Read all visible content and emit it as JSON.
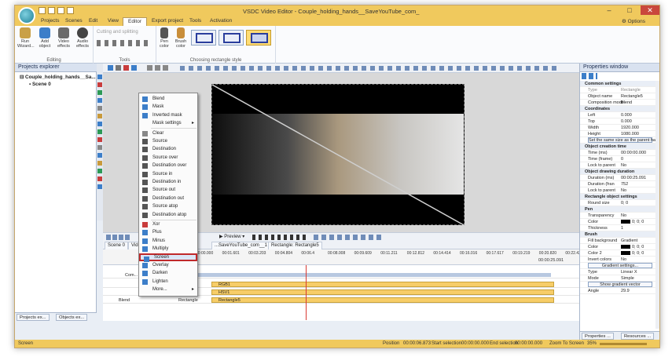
{
  "title": "VSDC Video Editor - Couple_holding_hands__SaveYouTube_com_",
  "window_controls": [
    "–",
    "□",
    "✕"
  ],
  "menu": {
    "items": [
      "Projects",
      "Scenes",
      "Edit",
      "View",
      "Editor",
      "Export project",
      "Tools",
      "Activation"
    ],
    "active": "Editor",
    "options": "Options"
  },
  "ribbon": {
    "editing_group": "Editing",
    "tools_group": "Tools",
    "styles_group": "Choosing rectangle style",
    "run_wizard": "Run Wizard...",
    "add_object": "Add object",
    "video_effects": "Video effects",
    "audio_effects": "Audio effects",
    "cutting": "Cutting and splitting",
    "pen_color": "Pen color",
    "brush_color": "Brush color"
  },
  "projects_explorer": {
    "title": "Projects explorer",
    "project": "Couple_holding_hands__Sa...",
    "scene": "Scene 0",
    "bottom_tabs": [
      "Projects ex...",
      "Objects ex..."
    ]
  },
  "context_menu": {
    "items": [
      "Blend",
      "Mask",
      "Inverted mask",
      "Mask settings",
      "Clear",
      "Source",
      "Destination",
      "Source over",
      "Destination over",
      "Source in",
      "Destination in",
      "Source out",
      "Destination out",
      "Source atop",
      "Destination atop",
      "Xor",
      "Plus",
      "Minus",
      "Multiply",
      "Screen",
      "Overlay",
      "Darken",
      "Lighten",
      "More..."
    ],
    "highlighted": "Screen"
  },
  "playbar": {
    "preview": "Preview"
  },
  "timeline": {
    "tabs": [
      "Scene 0",
      "Video",
      "...SaveYouTube_com__1",
      "Rectangle: Rectangle5"
    ],
    "ruler_ticks": [
      "00:00.000",
      "00:01.601",
      "00:03.203",
      "00:04.804",
      "00:06.4",
      "00:08.008",
      "00:09.609",
      "00:11.211",
      "00:12.812",
      "00:14.414",
      "00:16.016",
      "00:17.617",
      "00:19.219",
      "00:20.820",
      "00:22.422",
      "00:24.024",
      "00:25.625",
      "00:27.2"
    ],
    "end_time": "00:00:25.091",
    "layer_label": "Com...",
    "blend_label": "Blend",
    "tracks": [
      "RGB1",
      "HSV1",
      "Rectangle5"
    ],
    "rect_row_label": "Rectangle"
  },
  "properties": {
    "title": "Properties window",
    "rows": [
      {
        "type": "sec",
        "k": "Common settings"
      },
      {
        "type": "dim",
        "k": "Type",
        "v": "Rectangle"
      },
      {
        "type": "row",
        "k": "Object name",
        "v": "Rectangle5"
      },
      {
        "type": "row",
        "k": "Composition mode",
        "v": "Blend"
      },
      {
        "type": "sec",
        "k": "Coordinates"
      },
      {
        "type": "row",
        "k": "Left",
        "v": "0.000"
      },
      {
        "type": "row",
        "k": "Top",
        "v": "0.000"
      },
      {
        "type": "row",
        "k": "Width",
        "v": "1920.000"
      },
      {
        "type": "row",
        "k": "Height",
        "v": "1080.000"
      },
      {
        "type": "btn",
        "k": "Set the same size as the parent has"
      },
      {
        "type": "sec",
        "k": "Object creation time"
      },
      {
        "type": "row",
        "k": "Time (ms)",
        "v": "00:00:00.000"
      },
      {
        "type": "row",
        "k": "Time (frame)",
        "v": "0"
      },
      {
        "type": "row",
        "k": "Lock to parent",
        "v": "No"
      },
      {
        "type": "sec",
        "k": "Object drawing duration"
      },
      {
        "type": "row",
        "k": "Duration (ms)",
        "v": "00:00:25.091"
      },
      {
        "type": "row",
        "k": "Duration (fran",
        "v": "752"
      },
      {
        "type": "row",
        "k": "Lock to parent",
        "v": "No"
      },
      {
        "type": "sec",
        "k": "Rectangle object settings"
      },
      {
        "type": "row",
        "k": "Round size",
        "v": "0; 0"
      },
      {
        "type": "sec",
        "k": "Pen"
      },
      {
        "type": "row",
        "k": "Transparency",
        "v": "No"
      },
      {
        "type": "color",
        "k": "Color",
        "v": "0; 0; 0"
      },
      {
        "type": "row",
        "k": "Thickness",
        "v": "1"
      },
      {
        "type": "sec",
        "k": "Brush"
      },
      {
        "type": "row",
        "k": "Fill background",
        "v": "Gradient"
      },
      {
        "type": "color",
        "k": "Color",
        "v": "0; 0; 0"
      },
      {
        "type": "color",
        "k": "Color 2",
        "v": "0; 0; 0"
      },
      {
        "type": "row",
        "k": "Invert colors",
        "v": "No"
      },
      {
        "type": "btn",
        "k": "Gradient settings..."
      },
      {
        "type": "row",
        "k": "Type",
        "v": "Linear X"
      },
      {
        "type": "row",
        "k": "Mode",
        "v": "Simple"
      },
      {
        "type": "btn",
        "k": "Show gradient vector"
      },
      {
        "type": "row",
        "k": "Angle",
        "v": "29.9"
      }
    ],
    "bottom_tabs": [
      "Properties ...",
      "Resources ..."
    ]
  },
  "status": {
    "left": "Screen",
    "position_label": "Position",
    "position": "00:00:06.873",
    "start_label": "Start selection",
    "start": "00:00:00.000",
    "end_label": "End selection",
    "end": "00:00:00.000",
    "zoom_label": "Zoom To Screen",
    "zoom": "35%"
  },
  "colors": {
    "accent": "#f0c95d",
    "highlight_border": "#c0282a",
    "clip": "#f7cd68",
    "cursor": "#d93a32"
  }
}
